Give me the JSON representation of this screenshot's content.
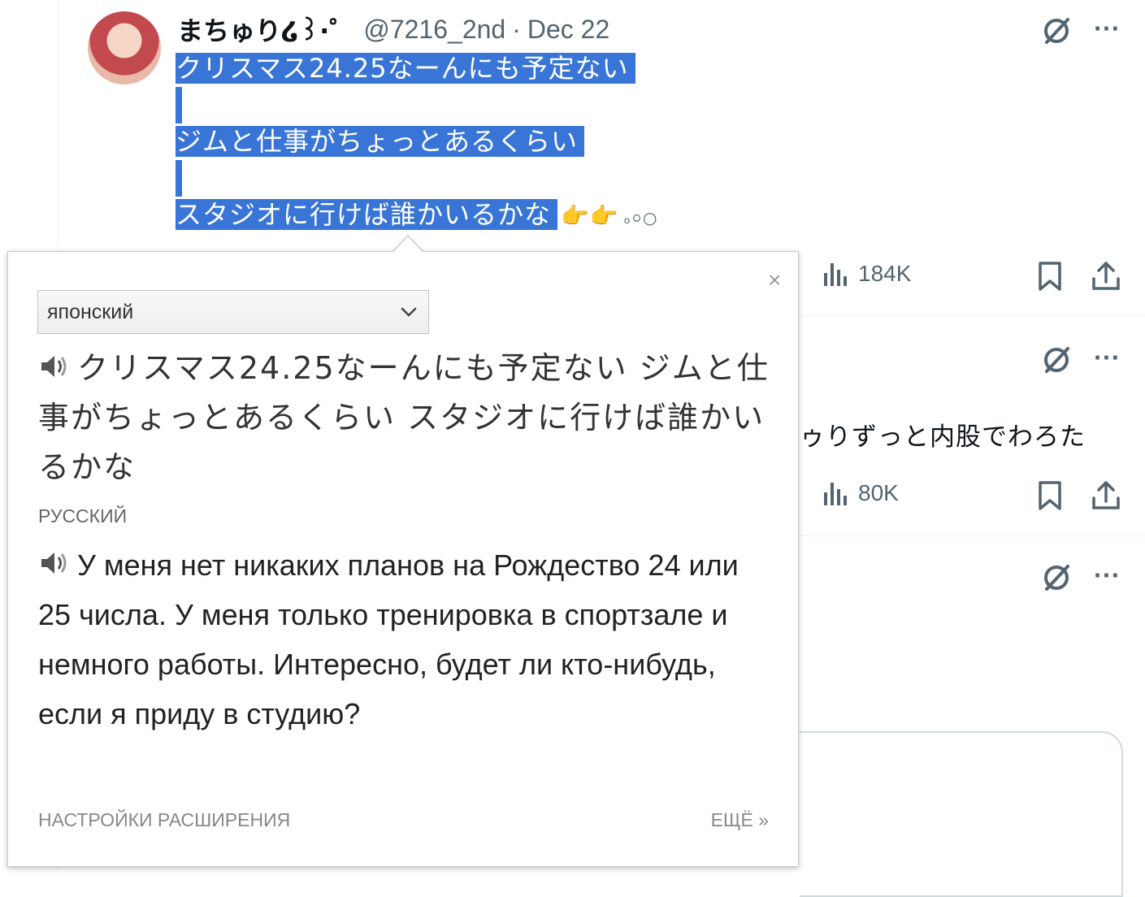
{
  "tweet": {
    "author_name": "まちゅり໒꒱·゜",
    "handle": "@7216_2nd",
    "separator": "·",
    "date": "Dec 22",
    "lines": [
      "クリスマス24.25なーんにも予定ない",
      "ジムと仕事がちょっとあるくらい",
      "スタジオに行けば誰かいるかな"
    ],
    "emoji": "👉👉",
    "trailing": "ₒ০○",
    "views": "184K"
  },
  "second_tweet": {
    "partial_text": "ゥりずっと内股でわろた",
    "views": "80K"
  },
  "translator": {
    "close_label": "×",
    "source_language": "японский",
    "source_text": "クリスマス24.25なーんにも予定ない ジムと仕事がちょっとあるくらい スタジオに行けば誰かいるかな",
    "target_language": "РУССКИЙ",
    "translated_text": "У меня нет никаких планов на Рождество 24 или 25 числа. У меня только тренировка в спортзале и немного работы. Интересно, будет ли кто-нибудь, если я приду в студию?",
    "settings_label": "НАСТРОЙКИ РАСШИРЕНИЯ",
    "more_label": "ЕЩЁ »"
  },
  "icons": [
    "grok-icon",
    "more-icon",
    "views-icon",
    "bookmark-icon",
    "share-icon",
    "speaker-icon",
    "chevron-down-icon"
  ],
  "colors": {
    "selection": "#3875d7",
    "muted": "#536471"
  }
}
